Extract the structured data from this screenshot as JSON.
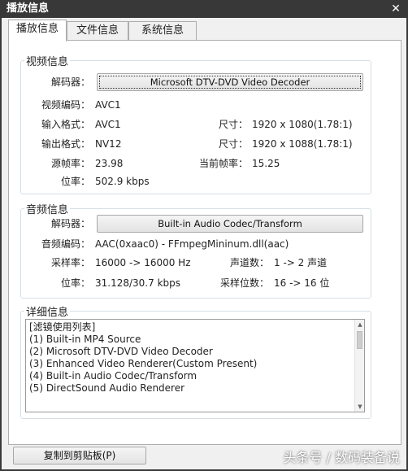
{
  "window": {
    "title": "播放信息",
    "close_glyph": "✕"
  },
  "tabs": [
    {
      "label": "播放信息",
      "active": true
    },
    {
      "label": "文件信息",
      "active": false
    },
    {
      "label": "系统信息",
      "active": false
    }
  ],
  "video": {
    "legend": "视频信息",
    "decoder_label": "解码器：",
    "decoder_value": "Microsoft DTV-DVD Video Decoder",
    "codec_label": "视频编码：",
    "codec_value": "AVC1",
    "input_format_label": "输入格式：",
    "input_format_value": "AVC1",
    "input_size_label": "尺寸：",
    "input_size_value": "1920 x 1080(1.78:1)",
    "output_format_label": "输出格式：",
    "output_format_value": "NV12",
    "output_size_label": "尺寸：",
    "output_size_value": "1920 x 1088(1.78:1)",
    "src_fps_label": "源帧率：",
    "src_fps_value": "23.98",
    "cur_fps_label": "当前帧率：",
    "cur_fps_value": "15.25",
    "bitrate_label": "位率：",
    "bitrate_value": "502.9 kbps"
  },
  "audio": {
    "legend": "音频信息",
    "decoder_label": "解码器：",
    "decoder_value": "Built-in Audio Codec/Transform",
    "codec_label": "音频编码：",
    "codec_value": "AAC(0xaac0) - FFmpegMininum.dll(aac)",
    "samplerate_label": "采样率：",
    "samplerate_value": "16000 -> 16000 Hz",
    "channels_label": "声道数：",
    "channels_value": "1 -> 2 声道",
    "bitrate_label": "位率：",
    "bitrate_value": "31.128/30.7 kbps",
    "bits_label": "采样位数：",
    "bits_value": "16 -> 16 位"
  },
  "details": {
    "legend": "详细信息",
    "items": [
      "[滤镜使用列表]",
      "(1) Built-in MP4 Source",
      "(2) Microsoft DTV-DVD Video Decoder",
      "(3) Enhanced Video Renderer(Custom Present)",
      "(4) Built-in Audio Codec/Transform",
      "(5) DirectSound Audio Renderer"
    ]
  },
  "copy_button_label": "复制到剪贴板(P)",
  "watermark": "头条号 / 数码装备说",
  "icons": {
    "scroll_up": "▲",
    "scroll_down": "▼"
  },
  "colors": {
    "titlebar": "#383838",
    "dialog_bg": "#f0f0f0",
    "group_border": "#d5dfe5"
  }
}
